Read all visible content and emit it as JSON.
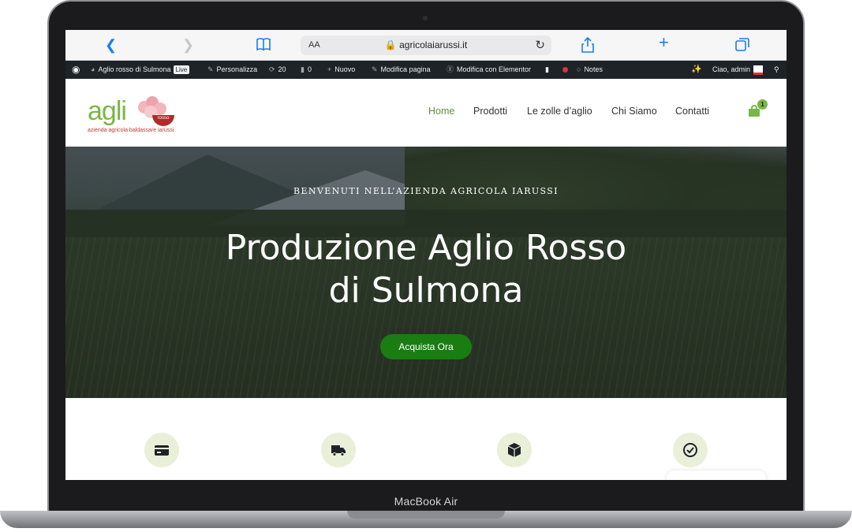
{
  "device": {
    "label": "MacBook Air"
  },
  "safari": {
    "text_size_label": "AA",
    "url": "agricolaiarussi.it"
  },
  "wp_admin_bar": {
    "site_name": "Aglio rosso di Sulmona",
    "live_badge": "Live",
    "customize": "Personalizza",
    "updates_count": "20",
    "comments_count": "0",
    "new": "Nuovo",
    "edit_page": "Modifica pagina",
    "edit_elementor": "Modifica con Elementor",
    "notes": "Notes",
    "greeting": "Ciao, admin"
  },
  "site": {
    "logo": {
      "wordmark": "agli",
      "badge_text": "rosso",
      "tagline": "azienda agricola baldassare iarussi"
    },
    "nav": [
      {
        "label": "Home",
        "active": true
      },
      {
        "label": "Prodotti",
        "active": false
      },
      {
        "label": "Le zolle d’aglio",
        "active": false
      },
      {
        "label": "Chi Siamo",
        "active": false
      },
      {
        "label": "Contatti",
        "active": false
      }
    ],
    "cart_count": "1",
    "accent_color": "#1a7d12"
  },
  "hero": {
    "kicker": "BENVENUTI NELL’AZIENDA AGRICOLA IARUSSI",
    "title_line1": "Produzione Aglio Rosso",
    "title_line2": "di Sulmona",
    "cta": "Acquista Ora"
  },
  "features": [
    {
      "icon": "credit-card-icon"
    },
    {
      "icon": "truck-icon"
    },
    {
      "icon": "box-icon"
    },
    {
      "icon": "check-circle-icon"
    }
  ]
}
